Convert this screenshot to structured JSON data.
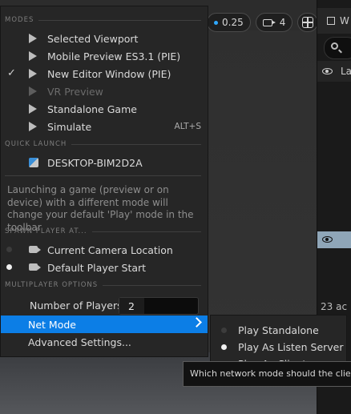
{
  "viewport": {
    "speed_value": "0.25",
    "camera_speed": "4"
  },
  "outliner": {
    "tab_label": "W",
    "header_label": "La",
    "item_count": "23 ac"
  },
  "menu": {
    "sections": {
      "modes": "MODES",
      "quick_launch": "QUICK LAUNCH",
      "spawn": "SPAWN PLAYER AT...",
      "multiplayer": "MULTIPLAYER OPTIONS"
    },
    "modes": [
      {
        "label": "Selected Viewport",
        "checked": false,
        "disabled": false,
        "shortcut": ""
      },
      {
        "label": "Mobile Preview ES3.1 (PIE)",
        "checked": false,
        "disabled": false,
        "shortcut": ""
      },
      {
        "label": "New Editor Window (PIE)",
        "checked": true,
        "disabled": false,
        "shortcut": ""
      },
      {
        "label": "VR Preview",
        "checked": false,
        "disabled": true,
        "shortcut": ""
      },
      {
        "label": "Standalone Game",
        "checked": false,
        "disabled": false,
        "shortcut": ""
      },
      {
        "label": "Simulate",
        "checked": false,
        "disabled": false,
        "shortcut": "ALT+S"
      }
    ],
    "quick_launch_device": "DESKTOP-BIM2D2A",
    "help_text": "Launching a game (preview or on device) with a different mode will change your default 'Play' mode in the toolbar",
    "spawn": [
      {
        "label": "Current Camera Location",
        "selected": false
      },
      {
        "label": "Default Player Start",
        "selected": true
      }
    ],
    "num_players_label": "Number of Players",
    "num_players_value": "2",
    "net_mode_label": "Net Mode",
    "advanced_label": "Advanced Settings..."
  },
  "submenu": {
    "items": [
      {
        "label": "Play Standalone",
        "selected": false
      },
      {
        "label": "Play As Listen Server",
        "selected": true
      },
      {
        "label": "Play As Client",
        "selected": false
      }
    ]
  },
  "tooltip": "Which network mode should the clients launch in? A server will automatically be started if needed.",
  "colors": {
    "highlight": "#0c7ee6",
    "menu_bg": "#262626",
    "accent_dot": "#2fa8ff"
  }
}
